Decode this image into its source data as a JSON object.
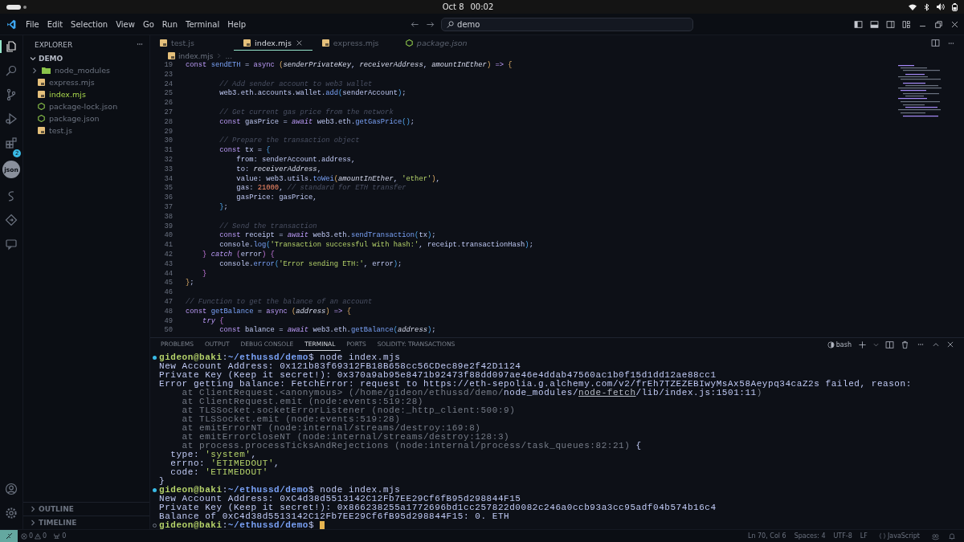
{
  "system_bar": {
    "date": "Oct 8",
    "time": "00:02"
  },
  "menu": [
    "File",
    "Edit",
    "Selection",
    "View",
    "Go",
    "Run",
    "Terminal",
    "Help"
  ],
  "command_center": "demo",
  "activity_bar": [
    {
      "kind": "files",
      "selected": true
    },
    {
      "kind": "search",
      "selected": false
    },
    {
      "kind": "source-control",
      "selected": false
    },
    {
      "kind": "run",
      "selected": false
    },
    {
      "kind": "extensions",
      "selected": false,
      "badge": "2"
    },
    {
      "kind": "json",
      "selected": false,
      "text": "json"
    },
    {
      "kind": "swirl",
      "selected": false
    },
    {
      "kind": "diamond",
      "selected": false
    },
    {
      "kind": "chat",
      "selected": false
    }
  ],
  "explorer": {
    "title": "EXPLORER",
    "folder": "DEMO",
    "expanded": true,
    "items": [
      {
        "kind": "folder",
        "name": "node_modules",
        "selected": false
      },
      {
        "kind": "js",
        "name": "express.mjs",
        "selected": false
      },
      {
        "kind": "js",
        "name": "index.mjs",
        "selected": true
      },
      {
        "kind": "json",
        "name": "package-lock.json",
        "selected": false
      },
      {
        "kind": "json",
        "name": "package.json",
        "selected": false
      },
      {
        "kind": "js",
        "name": "test.js",
        "selected": false
      }
    ],
    "sections": [
      {
        "label": "OUTLINE",
        "expanded": false
      },
      {
        "label": "TIMELINE",
        "expanded": false
      }
    ]
  },
  "tabs": [
    {
      "label": "test.js",
      "kind": "js",
      "selected": false,
      "preview": false
    },
    {
      "label": "index.mjs",
      "kind": "js",
      "selected": true,
      "preview": false
    },
    {
      "label": "express.mjs",
      "kind": "js",
      "selected": false,
      "preview": false
    },
    {
      "label": "package.json",
      "kind": "json",
      "selected": false,
      "preview": true
    }
  ],
  "breadcrumb": {
    "kind": "js",
    "file": "index.mjs",
    "rest": "..."
  },
  "code_lines": [
    {
      "num": "19",
      "tokens": [
        {
          "kind": "kw",
          "text": "const "
        },
        {
          "kind": "fn",
          "text": "sendETH"
        },
        {
          "kind": "p",
          "text": " = "
        },
        {
          "kind": "kw",
          "text": "async "
        },
        {
          "kind": "b1",
          "text": "("
        },
        {
          "kind": "prm",
          "text": "senderPrivateKey"
        },
        {
          "kind": "p",
          "text": ", "
        },
        {
          "kind": "prm",
          "text": "receiverAddress"
        },
        {
          "kind": "p",
          "text": ", "
        },
        {
          "kind": "prm",
          "text": "amountInEther"
        },
        {
          "kind": "b1",
          "text": ")"
        },
        {
          "kind": "kw",
          "text": " => "
        },
        {
          "kind": "b1",
          "text": "{"
        }
      ]
    },
    {
      "num": "23"
    },
    {
      "num": "24",
      "tokens": [
        {
          "kind": "cmt",
          "text": "        // Add sender account to web3 wallet"
        }
      ]
    },
    {
      "num": "25",
      "tokens": [
        {
          "kind": "p",
          "text": "        web3.eth.accounts.wallet."
        },
        {
          "kind": "fn",
          "text": "add"
        },
        {
          "kind": "b3",
          "text": "("
        },
        {
          "kind": "p",
          "text": "senderAccount"
        },
        {
          "kind": "b3",
          "text": ")"
        },
        {
          "kind": "p",
          "text": ";"
        }
      ]
    },
    {
      "num": "26"
    },
    {
      "num": "27",
      "tokens": [
        {
          "kind": "cmt",
          "text": "        // Get current gas price from the network"
        }
      ]
    },
    {
      "num": "28",
      "tokens": [
        {
          "kind": "kw",
          "text": "        const "
        },
        {
          "kind": "p",
          "text": "gasPrice = "
        },
        {
          "kind": "kwi",
          "text": "await "
        },
        {
          "kind": "p",
          "text": "web3.eth."
        },
        {
          "kind": "fn",
          "text": "getGasPrice"
        },
        {
          "kind": "b3",
          "text": "()"
        },
        {
          "kind": "p",
          "text": ";"
        }
      ]
    },
    {
      "num": "29"
    },
    {
      "num": "30",
      "tokens": [
        {
          "kind": "cmt",
          "text": "        // Prepare the transaction object"
        }
      ]
    },
    {
      "num": "31",
      "tokens": [
        {
          "kind": "kw",
          "text": "        const "
        },
        {
          "kind": "p",
          "text": "tx = "
        },
        {
          "kind": "b3",
          "text": "{"
        }
      ]
    },
    {
      "num": "32",
      "tokens": [
        {
          "kind": "p",
          "text": "            from: senderAccount.address,"
        }
      ]
    },
    {
      "num": "33",
      "tokens": [
        {
          "kind": "p",
          "text": "            to: "
        },
        {
          "kind": "prm",
          "text": "receiverAddress"
        },
        {
          "kind": "p",
          "text": ","
        }
      ]
    },
    {
      "num": "34",
      "tokens": [
        {
          "kind": "p",
          "text": "            value: web3.utils."
        },
        {
          "kind": "fn",
          "text": "toWei"
        },
        {
          "kind": "b1",
          "text": "("
        },
        {
          "kind": "prm",
          "text": "amountInEther"
        },
        {
          "kind": "p",
          "text": ", "
        },
        {
          "kind": "str",
          "text": "'ether'"
        },
        {
          "kind": "b1",
          "text": ")"
        },
        {
          "kind": "p",
          "text": ","
        }
      ]
    },
    {
      "num": "35",
      "tokens": [
        {
          "kind": "p",
          "text": "            gas: "
        },
        {
          "kind": "num",
          "text": "21000"
        },
        {
          "kind": "p",
          "text": ", "
        },
        {
          "kind": "cmt",
          "text": "// standard for ETH transfer"
        }
      ]
    },
    {
      "num": "36",
      "tokens": [
        {
          "kind": "p",
          "text": "            gasPrice: gasPrice,"
        }
      ]
    },
    {
      "num": "37",
      "tokens": [
        {
          "kind": "b3",
          "text": "        }"
        },
        {
          "kind": "p",
          "text": ";"
        }
      ]
    },
    {
      "num": "38"
    },
    {
      "num": "39",
      "tokens": [
        {
          "kind": "cmt",
          "text": "        // Send the transaction"
        }
      ]
    },
    {
      "num": "40",
      "tokens": [
        {
          "kind": "kw",
          "text": "        const "
        },
        {
          "kind": "p",
          "text": "receipt = "
        },
        {
          "kind": "kwi",
          "text": "await "
        },
        {
          "kind": "p",
          "text": "web3.eth."
        },
        {
          "kind": "fn",
          "text": "sendTransaction"
        },
        {
          "kind": "b3",
          "text": "("
        },
        {
          "kind": "p",
          "text": "tx"
        },
        {
          "kind": "b3",
          "text": ")"
        },
        {
          "kind": "p",
          "text": ";"
        }
      ]
    },
    {
      "num": "41",
      "tokens": [
        {
          "kind": "p",
          "text": "        console."
        },
        {
          "kind": "fn",
          "text": "log"
        },
        {
          "kind": "b3",
          "text": "("
        },
        {
          "kind": "str",
          "text": "'Transaction successful with hash:'"
        },
        {
          "kind": "p",
          "text": ", receipt.transactionHash"
        },
        {
          "kind": "b3",
          "text": ")"
        },
        {
          "kind": "p",
          "text": ";"
        }
      ]
    },
    {
      "num": "42",
      "tokens": [
        {
          "kind": "b2",
          "text": "    }"
        },
        {
          "kind": "kwi",
          "text": " catch "
        },
        {
          "kind": "b2",
          "text": "("
        },
        {
          "kind": "p",
          "text": "error"
        },
        {
          "kind": "b2",
          "text": ") {"
        }
      ]
    },
    {
      "num": "43",
      "tokens": [
        {
          "kind": "p",
          "text": "        console."
        },
        {
          "kind": "fn",
          "text": "error"
        },
        {
          "kind": "b3",
          "text": "("
        },
        {
          "kind": "str",
          "text": "'Error sending ETH:'"
        },
        {
          "kind": "p",
          "text": ", error"
        },
        {
          "kind": "b3",
          "text": ")"
        },
        {
          "kind": "p",
          "text": ";"
        }
      ]
    },
    {
      "num": "44",
      "tokens": [
        {
          "kind": "b2",
          "text": "    }"
        }
      ]
    },
    {
      "num": "45",
      "tokens": [
        {
          "kind": "b1",
          "text": "}"
        },
        {
          "kind": "p",
          "text": ";"
        }
      ]
    },
    {
      "num": "46"
    },
    {
      "num": "47",
      "tokens": [
        {
          "kind": "cmt",
          "text": "// Function to get the balance of an account"
        }
      ]
    },
    {
      "num": "48",
      "tokens": [
        {
          "kind": "kw",
          "text": "const "
        },
        {
          "kind": "fn",
          "text": "getBalance"
        },
        {
          "kind": "p",
          "text": " = "
        },
        {
          "kind": "kw",
          "text": "async "
        },
        {
          "kind": "b1",
          "text": "("
        },
        {
          "kind": "prm",
          "text": "address"
        },
        {
          "kind": "b1",
          "text": ")"
        },
        {
          "kind": "kw",
          "text": " => "
        },
        {
          "kind": "b1",
          "text": "{"
        }
      ]
    },
    {
      "num": "49",
      "tokens": [
        {
          "kind": "kwi",
          "text": "    try "
        },
        {
          "kind": "b2",
          "text": "{"
        }
      ]
    },
    {
      "num": "50",
      "tokens": [
        {
          "kind": "kw",
          "text": "        const "
        },
        {
          "kind": "p",
          "text": "balance = "
        },
        {
          "kind": "kwi",
          "text": "await "
        },
        {
          "kind": "p",
          "text": "web3.eth."
        },
        {
          "kind": "fn",
          "text": "getBalance"
        },
        {
          "kind": "b3",
          "text": "("
        },
        {
          "kind": "prm",
          "text": "address"
        },
        {
          "kind": "b3",
          "text": ")"
        },
        {
          "kind": "p",
          "text": ";"
        }
      ]
    }
  ],
  "panel": {
    "tabs": [
      {
        "label": "PROBLEMS",
        "selected": false
      },
      {
        "label": "OUTPUT",
        "selected": false
      },
      {
        "label": "DEBUG CONSOLE",
        "selected": false
      },
      {
        "label": "TERMINAL",
        "selected": true
      },
      {
        "label": "PORTS",
        "selected": false
      },
      {
        "label": "SOLIDITY: TRANSACTIONS",
        "selected": false
      }
    ],
    "shell": "bash",
    "lines": [
      {
        "kind": "prompt",
        "finished": true,
        "tokens": [
          {
            "kind": "usr",
            "text": "gideon@baki"
          },
          {
            "kind": "p",
            "text": ":"
          },
          {
            "kind": "path",
            "text": "~/ethussd/demo"
          },
          {
            "kind": "p",
            "text": "$ node index.mjs"
          }
        ]
      },
      {
        "kind": "output",
        "tokens": [
          {
            "kind": "p",
            "text": "New Account Address: 0x121b83f69312FB18B658cc56CDec89e2f42D1124"
          }
        ]
      },
      {
        "kind": "output",
        "tokens": [
          {
            "kind": "p",
            "text": "Private Key (Keep it secret!): 0x370a9ab95e8471b92473f88dd097ae46e4ddab47560ac1b0f15d1dd12ae88cc1"
          }
        ]
      },
      {
        "kind": "output",
        "tokens": [
          {
            "kind": "p",
            "text": "Error getting balance: FetchError: request to https://eth-sepolia.g.alchemy.com/v2/frEh7TZEZEBIwyMsAx58Aeypq34caZ2s failed, reason:"
          }
        ]
      },
      {
        "kind": "output",
        "tokens": [
          {
            "kind": "dim",
            "text": "    at ClientRequest.<anonymous> (/home/gideon/ethussd/demo/"
          },
          {
            "kind": "p",
            "text": "node_modules/"
          },
          {
            "kind": "ul",
            "text": "node-fetch"
          },
          {
            "kind": "p",
            "text": "/lib/index.js:1501:11"
          },
          {
            "kind": "dim",
            "text": ")"
          }
        ]
      },
      {
        "kind": "output",
        "tokens": [
          {
            "kind": "dim",
            "text": "    at ClientRequest.emit (node:events:519:28)"
          }
        ]
      },
      {
        "kind": "output",
        "tokens": [
          {
            "kind": "dim",
            "text": "    at TLSSocket.socketErrorListener (node:_http_client:500:9)"
          }
        ]
      },
      {
        "kind": "output",
        "tokens": [
          {
            "kind": "dim",
            "text": "    at TLSSocket.emit (node:events:519:28)"
          }
        ]
      },
      {
        "kind": "output",
        "tokens": [
          {
            "kind": "dim",
            "text": "    at emitErrorNT (node:internal/streams/destroy:169:8)"
          }
        ]
      },
      {
        "kind": "output",
        "tokens": [
          {
            "kind": "dim",
            "text": "    at emitErrorCloseNT (node:internal/streams/destroy:128:3)"
          }
        ]
      },
      {
        "kind": "output",
        "tokens": [
          {
            "kind": "dim",
            "text": "    at process.processTicksAndRejections (node:internal/process/task_queues:82:21) "
          },
          {
            "kind": "p",
            "text": "{"
          }
        ]
      },
      {
        "kind": "output",
        "tokens": [
          {
            "kind": "p",
            "text": "  type: "
          },
          {
            "kind": "str",
            "text": "'system'"
          },
          {
            "kind": "p",
            "text": ","
          }
        ]
      },
      {
        "kind": "output",
        "tokens": [
          {
            "kind": "p",
            "text": "  errno: "
          },
          {
            "kind": "str",
            "text": "'ETIMEDOUT'"
          },
          {
            "kind": "p",
            "text": ","
          }
        ]
      },
      {
        "kind": "output",
        "tokens": [
          {
            "kind": "p",
            "text": "  code: "
          },
          {
            "kind": "str",
            "text": "'ETIMEDOUT'"
          }
        ]
      },
      {
        "kind": "output",
        "tokens": [
          {
            "kind": "p",
            "text": "}"
          }
        ]
      },
      {
        "kind": "prompt",
        "finished": true,
        "tokens": [
          {
            "kind": "usr",
            "text": "gideon@baki"
          },
          {
            "kind": "p",
            "text": ":"
          },
          {
            "kind": "path",
            "text": "~/ethussd/demo"
          },
          {
            "kind": "p",
            "text": "$ node index.mjs"
          }
        ]
      },
      {
        "kind": "output",
        "tokens": [
          {
            "kind": "p",
            "text": "New Account Address: 0xC4d38d5513142C12Fb7EE29Cf6fB95d298844F15"
          }
        ]
      },
      {
        "kind": "output",
        "tokens": [
          {
            "kind": "p",
            "text": "Private Key (Keep it secret!): 0x866238255a1772696bd1cc257822d0082c246a0ccb93a3cc95adf04b574b16c4"
          }
        ]
      },
      {
        "kind": "output",
        "tokens": [
          {
            "kind": "p",
            "text": "Balance of 0xC4d38d5513142C12Fb7EE29Cf6fB95d298844F15: 0. ETH"
          }
        ]
      },
      {
        "kind": "prompt",
        "finished": false,
        "tokens": [
          {
            "kind": "usr",
            "text": "gideon@baki"
          },
          {
            "kind": "p",
            "text": ":"
          },
          {
            "kind": "path",
            "text": "~/ethussd/demo"
          },
          {
            "kind": "p",
            "text": "$ "
          }
        ]
      }
    ]
  },
  "status_bar": {
    "errors": "0",
    "warnings": "0",
    "ports": "0",
    "items": [
      "Ln 70, Col 6",
      "Spaces: 4",
      "UTF-8",
      "LF"
    ],
    "language": "JavaScript"
  }
}
